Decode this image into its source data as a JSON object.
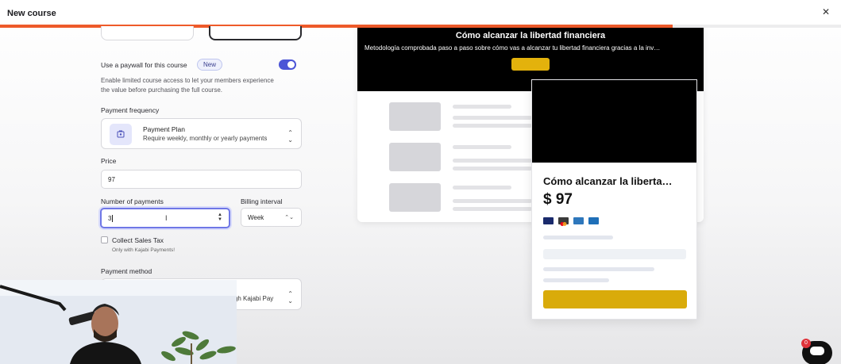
{
  "header": {
    "title": "New course",
    "close_icon": "close-icon",
    "progress_fraction": 0.8
  },
  "form": {
    "paywall": {
      "label": "Use a paywall for this course",
      "badge": "New",
      "enabled": true,
      "description_line1": "Enable limited course access to let your members experience",
      "description_line2": "the value before purchasing the full course."
    },
    "payment_frequency": {
      "label": "Payment frequency",
      "option_title": "Payment Plan",
      "option_desc": "Require weekly, monthly or yearly payments",
      "icon": "payment-plan-icon"
    },
    "price": {
      "label": "Price",
      "value": "97"
    },
    "number_of_payments": {
      "label": "Number of payments",
      "value": "3"
    },
    "billing_interval": {
      "label": "Billing interval",
      "value": "Week"
    },
    "sales_tax": {
      "label": "Collect Sales Tax",
      "note": "Only with Kajabi Payments!"
    },
    "payment_method": {
      "label": "Payment method",
      "value_partial": "ough Kajabi Pay"
    }
  },
  "preview": {
    "hero_title": "Cómo alcanzar la libertad financiera",
    "hero_subtitle": "Metodología comprobada paso a paso sobre cómo vas a alcanzar tu libertad financiera gracias a la inv…",
    "card_title": "Cómo alcanzar la liberta…",
    "card_price": "$ 97",
    "payment_icons": [
      "visa-icon",
      "mastercard-icon",
      "amex-icon",
      "diners-icon"
    ]
  },
  "chat": {
    "icon": "chat-icon",
    "badge_count": "0"
  },
  "colors": {
    "accent": "#ee5a2a",
    "toggle": "#4b55d6",
    "cta": "#d9ab0a"
  }
}
